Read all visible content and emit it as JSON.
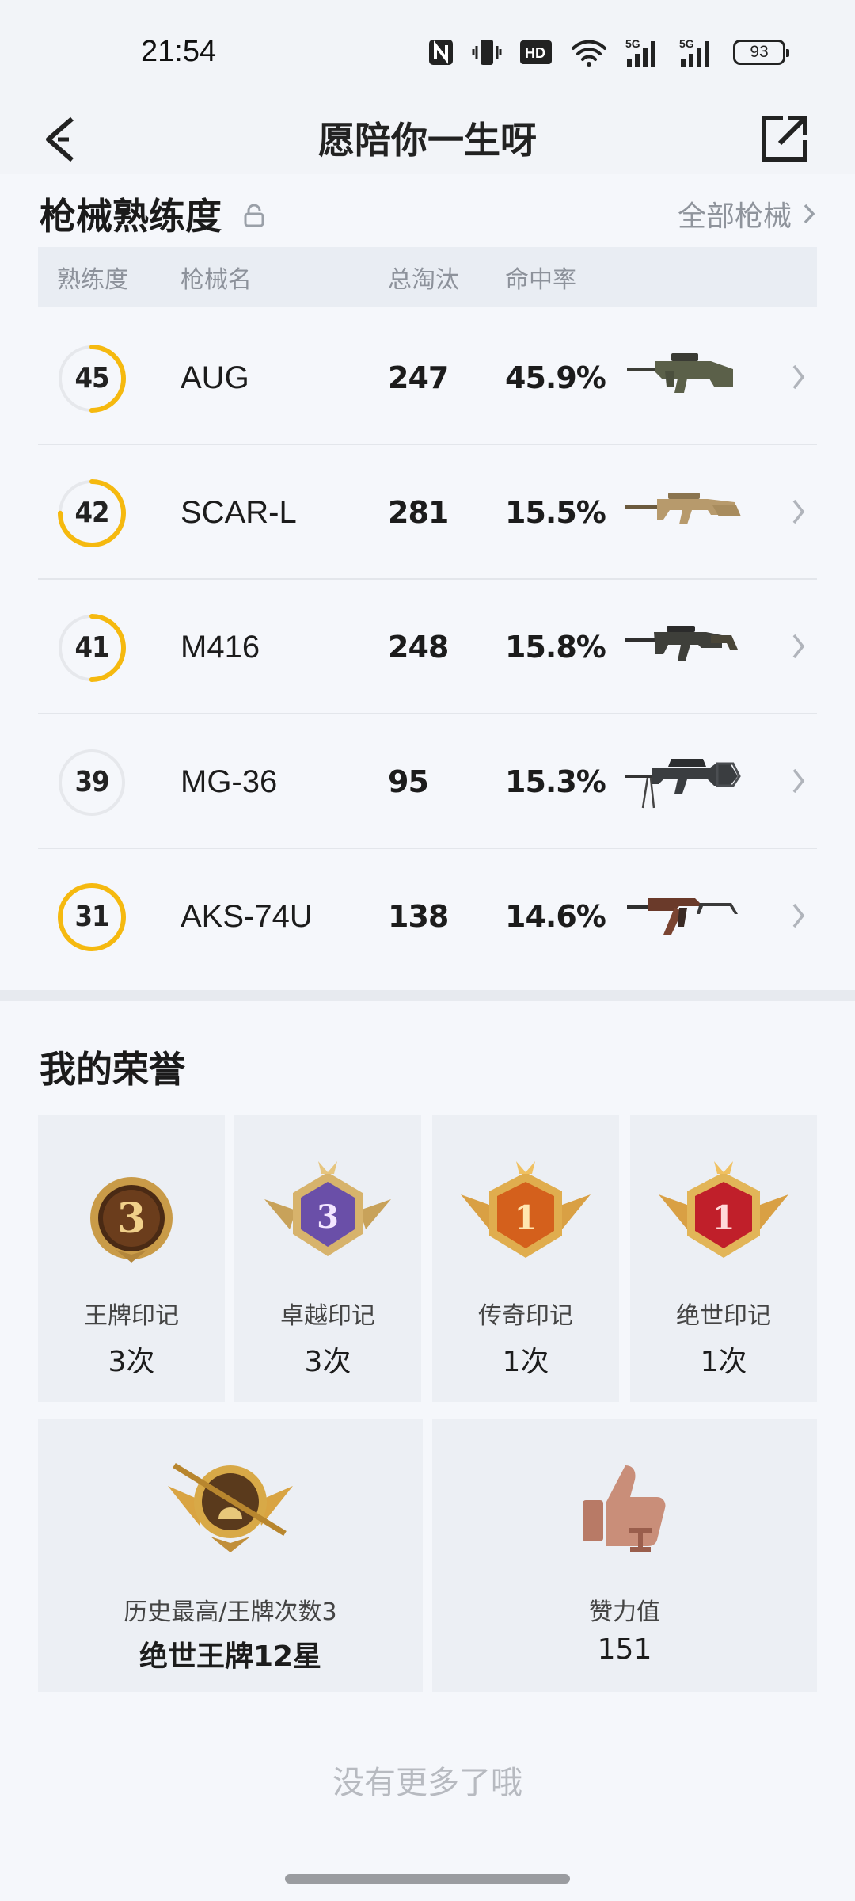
{
  "status": {
    "time": "21:54",
    "battery": "93"
  },
  "header": {
    "title": "愿陪你一生呀"
  },
  "weapons": {
    "title": "枪械熟练度",
    "all_link": "全部枪械",
    "columns": [
      "熟练度",
      "枪械名",
      "总淘汰",
      "命中率"
    ],
    "rows": [
      {
        "level": "45",
        "progress": 0.5,
        "name": "AUG",
        "kills": "247",
        "accuracy": "45.9%"
      },
      {
        "level": "42",
        "progress": 0.75,
        "name": "SCAR-L",
        "kills": "281",
        "accuracy": "15.5%"
      },
      {
        "level": "41",
        "progress": 0.5,
        "name": "M416",
        "kills": "248",
        "accuracy": "15.8%"
      },
      {
        "level": "39",
        "progress": 0.0,
        "name": "MG-36",
        "kills": "95",
        "accuracy": "15.3%"
      },
      {
        "level": "31",
        "progress": 1.0,
        "name": "AKS-74U",
        "kills": "138",
        "accuracy": "14.6%"
      }
    ]
  },
  "honors": {
    "title": "我的荣誉",
    "marks": [
      {
        "label": "王牌印记",
        "value": "3次",
        "badge_number": "3"
      },
      {
        "label": "卓越印记",
        "value": "3次",
        "badge_number": "3"
      },
      {
        "label": "传奇印记",
        "value": "1次",
        "badge_number": "1"
      },
      {
        "label": "绝世印记",
        "value": "1次",
        "badge_number": "1"
      }
    ],
    "best": {
      "label": "历史最高/王牌次数3",
      "value": "绝世王牌12星"
    },
    "charm": {
      "label": "赞力值",
      "value": "151"
    }
  },
  "footer": {
    "no_more": "没有更多了哦"
  },
  "colors": {
    "ring": "#f5b90f",
    "ring_track": "#e6e8ec",
    "background": "#f2f4f8"
  }
}
